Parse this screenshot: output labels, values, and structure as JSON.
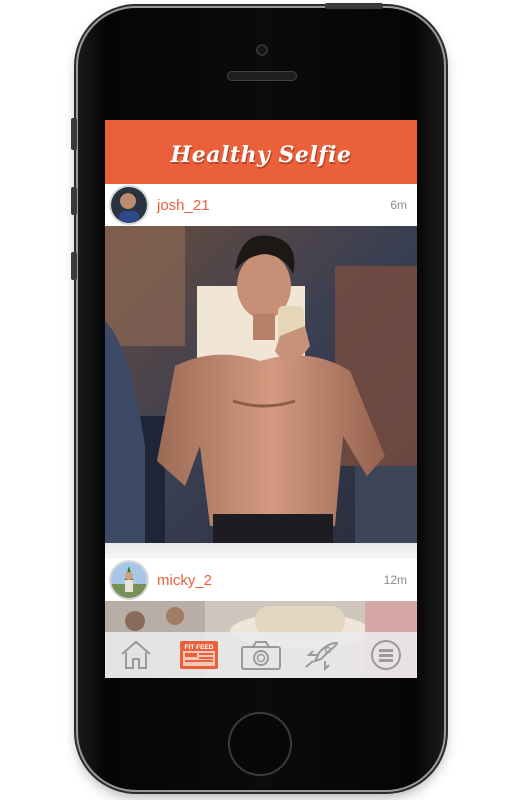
{
  "app": {
    "title": "Healthy Selfie"
  },
  "posts": [
    {
      "username": "josh_21",
      "time": "6m"
    },
    {
      "username": "micky_2",
      "time": "12m"
    }
  ],
  "tabbar": {
    "fit_feed_label": "FIT FEED",
    "tabs": [
      {
        "icon": "home-icon",
        "active": false
      },
      {
        "icon": "fit-feed-icon",
        "active": true
      },
      {
        "icon": "camera-icon",
        "active": false
      },
      {
        "icon": "rocket-icon",
        "active": false
      },
      {
        "icon": "menu-icon",
        "active": false
      }
    ]
  },
  "colors": {
    "accent": "#e9603b",
    "tab_inactive": "#9a9a9a"
  }
}
